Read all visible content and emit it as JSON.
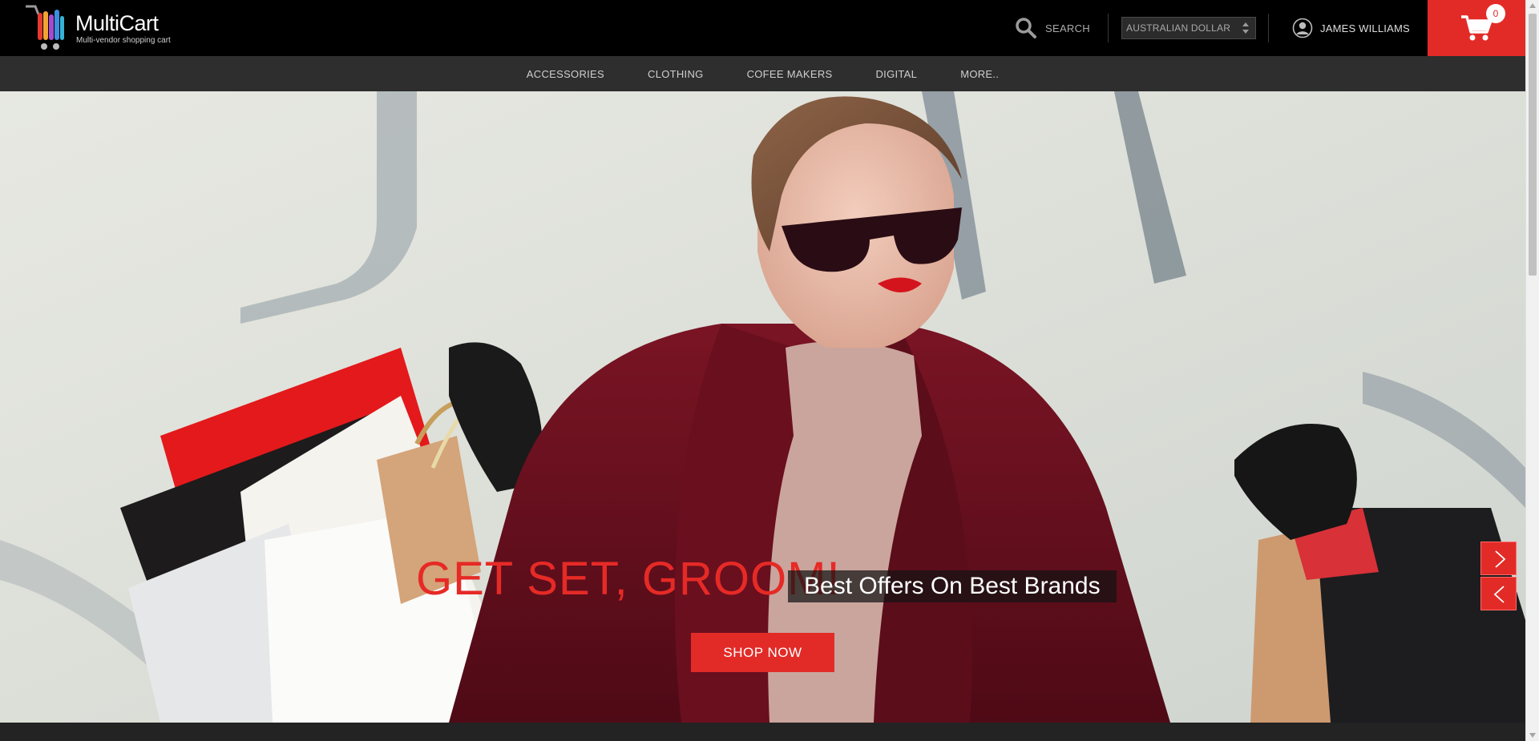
{
  "header": {
    "logo_name": "MultiCart",
    "logo_tagline": "Multi-vendor shopping cart",
    "search_label": "SEARCH",
    "currency": {
      "selected": "AUSTRALIAN DOLLAR"
    },
    "user_name": "JAMES WILLIAMS",
    "cart_count": "0",
    "accent_color": "#e22b27"
  },
  "nav": {
    "items": [
      {
        "label": "ACCESSORIES"
      },
      {
        "label": "CLOTHING"
      },
      {
        "label": "COFEE MAKERS"
      },
      {
        "label": "DIGITAL"
      },
      {
        "label": "MORE.."
      }
    ]
  },
  "hero": {
    "headline": "GET SET, GROOM!",
    "subline": "Best Offers On Best Brands",
    "cta_label": "SHOP NOW",
    "next_icon": "chevron-right-icon",
    "prev_icon": "chevron-left-icon"
  }
}
